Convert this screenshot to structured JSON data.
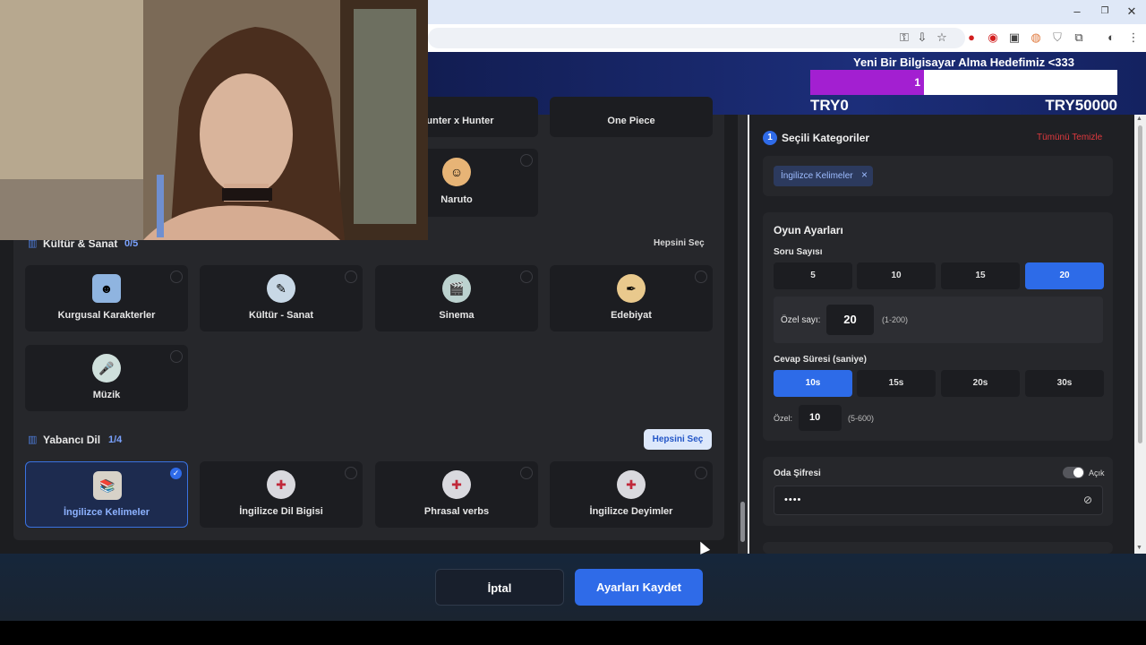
{
  "window": {
    "minimize": "–",
    "restore": "❐",
    "close": "✕"
  },
  "toolbar_icons": [
    "key-icon",
    "install-icon",
    "star-icon",
    "opera-icon",
    "record-icon",
    "extension-icon",
    "shield-icon",
    "puzzle-icon",
    "profile-icon",
    "menu-icon"
  ],
  "banner": {
    "title": "Yeni Bir Bilgisayar Alma Hedefimiz <333",
    "progress_value": "1",
    "progress_fraction": 0.37,
    "min_label": "TRY0",
    "max_label": "TRY50000"
  },
  "top_categories": {
    "items": [
      {
        "label": "Hunter x Hunter"
      },
      {
        "label": "One Piece"
      },
      {
        "label": "Naruto"
      }
    ]
  },
  "culture_section": {
    "title": "Kültür & Sanat",
    "count": "0/5",
    "select_all": "Hepsini Seç",
    "items": [
      {
        "label": "Kurgusal Karakterler"
      },
      {
        "label": "Kültür - Sanat"
      },
      {
        "label": "Sinema"
      },
      {
        "label": "Edebiyat"
      },
      {
        "label": "Müzik"
      }
    ]
  },
  "language_section": {
    "title": "Yabancı Dil",
    "count": "1/4",
    "select_all": "Hepsini Seç",
    "items": [
      {
        "label": "İngilizce Kelimeler",
        "selected": true
      },
      {
        "label": "İngilizce Dil Bigisi"
      },
      {
        "label": "Phrasal verbs"
      },
      {
        "label": "İngilizce Deyimler"
      }
    ]
  },
  "selected_panel": {
    "step": "1",
    "title": "Seçili Kategoriler",
    "clear_all": "Tümünü Temizle",
    "chips": [
      {
        "label": "İngilizce Kelimeler",
        "remove": "×"
      }
    ]
  },
  "game_settings": {
    "title": "Oyun Ayarları",
    "question_count_label": "Soru Sayısı",
    "question_options": [
      "5",
      "10",
      "15",
      "20"
    ],
    "question_selected": "20",
    "custom_label": "Özel sayı:",
    "custom_value": "20",
    "custom_range": "(1-200)",
    "answer_time_label": "Cevap Süresi (saniye)",
    "time_options": [
      "10s",
      "15s",
      "20s",
      "30s"
    ],
    "time_selected": "10s",
    "custom_time_label": "Özel:",
    "custom_time_value": "10",
    "custom_time_range": "(5-600)"
  },
  "room_password": {
    "title": "Oda Şifresi",
    "toggle_label": "Açık",
    "toggle_on": true,
    "value": "••••"
  },
  "footer": {
    "cancel": "İptal",
    "save": "Ayarları Kaydet"
  },
  "colors": {
    "accent": "#2f6be8",
    "danger": "#e0393e",
    "banner_fill": "#a31fd1"
  }
}
